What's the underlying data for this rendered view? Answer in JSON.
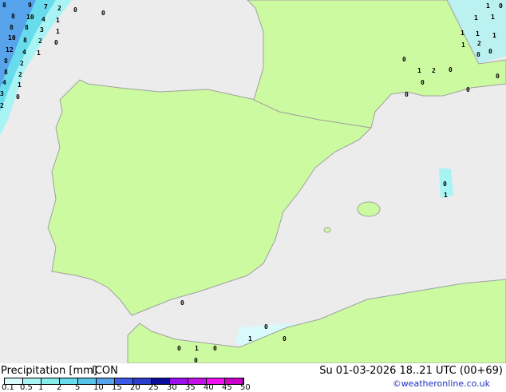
{
  "legend": {
    "title": "Precipitation [mm]",
    "model": "ICON",
    "datetime": "Su 01-03-2026 18..21 UTC (00+69)",
    "credit": "©weatheronline.co.uk",
    "ticks": [
      "0.1",
      "0.5",
      "1",
      "2",
      "5",
      "10",
      "15",
      "20",
      "25",
      "30",
      "35",
      "40",
      "45",
      "50"
    ],
    "colors": [
      "#d8fafa",
      "#a8f4f4",
      "#88ecec",
      "#68dcec",
      "#58c4ec",
      "#58a4ec",
      "#3c5ae8",
      "#2c3ccc",
      "#0c0c9c",
      "#9c10f0",
      "#c410e8",
      "#f010f0",
      "#c800c8"
    ]
  },
  "colors": {
    "sea": "#ececec",
    "land": "#ccfaa0",
    "border": "#a0a0a0"
  },
  "labels": [
    "8",
    "9",
    "7",
    "2",
    "0",
    "0",
    "8",
    "10",
    "4",
    "1",
    "8",
    "8",
    "3",
    "1",
    "10",
    "8",
    "2",
    "0",
    "12",
    "4",
    "1",
    "8",
    "2",
    "8",
    "2",
    "4",
    "1",
    "3",
    "0",
    "2",
    "1",
    "0",
    "1",
    "1",
    "1",
    "1",
    "1",
    "1",
    "2",
    "0",
    "0",
    "0",
    "1",
    "2",
    "0",
    "0",
    "0",
    "0",
    "0",
    "0",
    "1",
    "0",
    "0",
    "1",
    "0",
    "0",
    "1",
    "0",
    "0"
  ]
}
